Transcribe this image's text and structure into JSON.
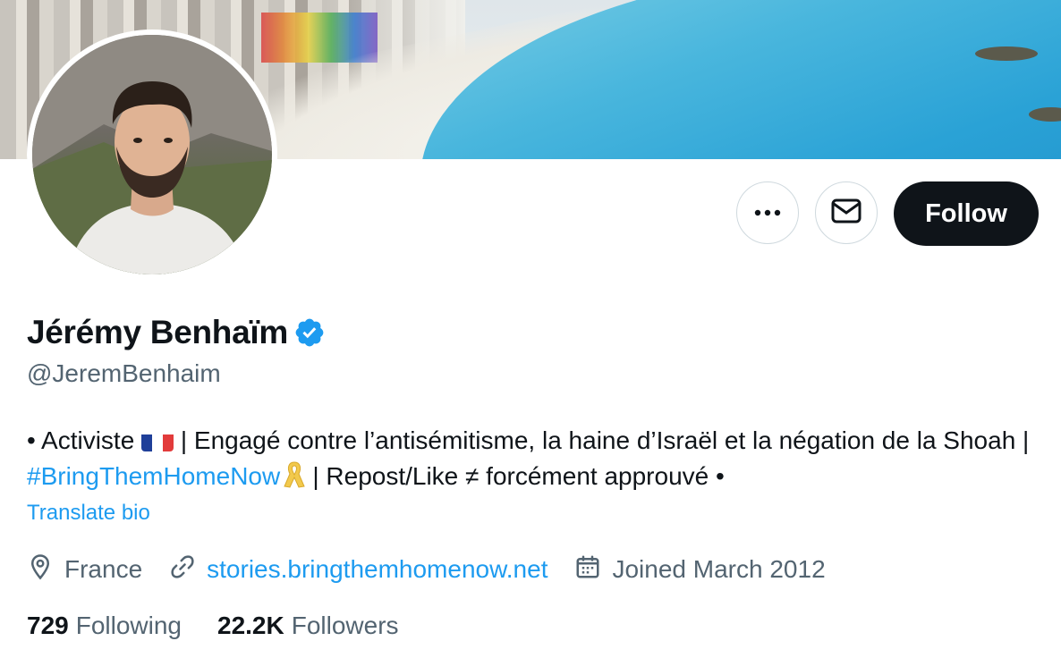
{
  "profile": {
    "display_name": "Jérémy Benhaïm",
    "handle": "@JeremBenhaim",
    "verified_icon": "verified-badge-icon",
    "verified_color": "#1d9bf0"
  },
  "actions": {
    "more_icon": "more-dots-icon",
    "message_icon": "envelope-icon",
    "follow_label": "Follow"
  },
  "bio": {
    "part1": "• Activiste ",
    "flag": "france-flag-emoji",
    "part2": " | Engagé contre l’antisémitisme, la haine d’Israël et la négation de la Shoah | ",
    "hashtag": "#BringThemHomeNow",
    "ribbon": "yellow-ribbon-emoji",
    "part3": " | Repost/Like ≠ forcément approuvé •",
    "translate_label": "Translate bio"
  },
  "meta": {
    "location": "France",
    "location_icon": "location-pin-icon",
    "website": "stories.bringthemhomenow.net",
    "website_icon": "link-icon",
    "joined": "Joined March 2012",
    "joined_icon": "calendar-icon"
  },
  "stats": {
    "following_count": "729",
    "following_label": "Following",
    "followers_count": "22.2K",
    "followers_label": "Followers"
  },
  "colors": {
    "accent": "#1d9bf0",
    "text_primary": "#0f1419",
    "text_secondary": "#536471",
    "follow_button_bg": "#0f1419"
  }
}
